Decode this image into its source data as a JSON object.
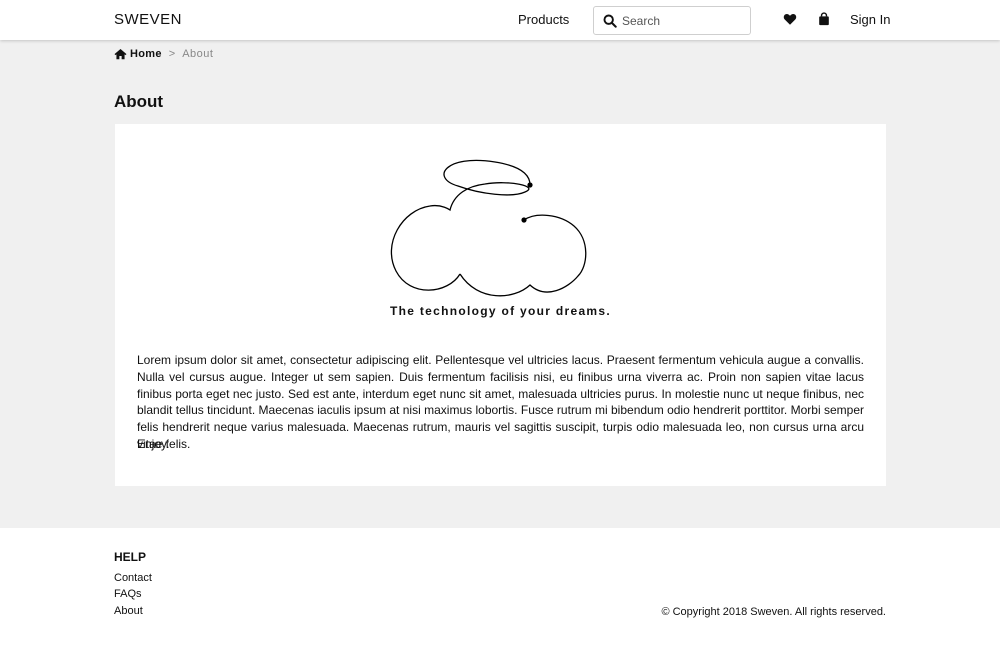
{
  "header": {
    "brand": "SWEVEN",
    "nav_products": "Products",
    "search_placeholder": "Search",
    "sign_in": "Sign In",
    "icons": [
      "search-icon",
      "heart-icon",
      "shopping-bag-icon"
    ]
  },
  "breadcrumb": {
    "home": "Home",
    "separator": ">",
    "current": "About"
  },
  "page": {
    "title": "About"
  },
  "about": {
    "tagline": "The technology of your dreams.",
    "body": "Lorem ipsum dolor sit amet, consectetur adipiscing elit. Pellentesque vel ultricies lacus. Praesent fermentum vehicula augue a convallis. Nulla vel cursus augue. Integer ut sem sapien. Duis fermentum facilisis nisi, eu finibus urna viverra ac. Proin non sapien vitae lacus finibus porta eget nec justo. Sed est ante, interdum eget nunc sit amet, malesuada ultricies purus. In molestie nunc ut neque finibus, nec blandit tellus tincidunt. Maecenas iaculis ipsum at nisi maximus lobortis. Fusce rutrum mi bibendum odio hendrerit porttitor. Morbi semper felis hendrerit neque varius malesuada. Maecenas rutrum, mauris vel sagittis suscipit, turpis odio malesuada leo, non cursus urna arcu vitae felis.",
    "closing": "Enjoy."
  },
  "footer": {
    "help_heading": "HELP",
    "links": [
      "Contact",
      "FAQs",
      "About"
    ],
    "copyright": "© Copyright 2018 Sweven. All rights reserved."
  },
  "colors": {
    "page_background": "#f0f0f0",
    "surface": "#ffffff",
    "text": "#111111",
    "muted": "#888888"
  }
}
